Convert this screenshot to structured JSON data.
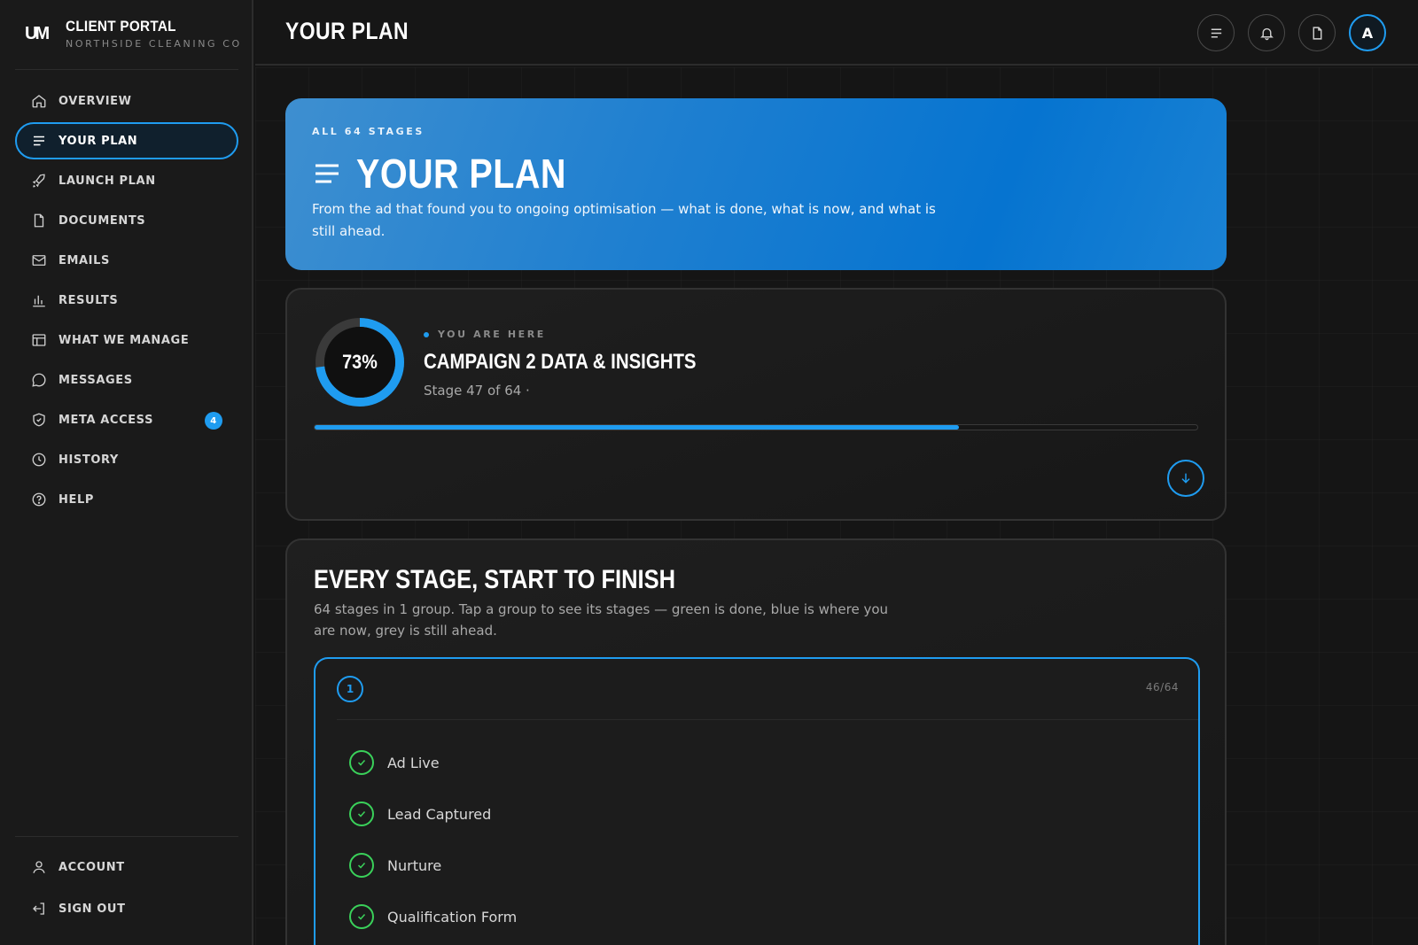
{
  "brand": {
    "logo": "UM",
    "title": "CLIENT PORTAL",
    "subtitle": "NORTHSIDE CLEANING CO"
  },
  "sidebar": {
    "items": [
      {
        "label": "OVERVIEW",
        "icon": "home-icon"
      },
      {
        "label": "YOUR PLAN",
        "icon": "list-icon",
        "active": true
      },
      {
        "label": "LAUNCH PLAN",
        "icon": "rocket-icon"
      },
      {
        "label": "DOCUMENTS",
        "icon": "document-icon"
      },
      {
        "label": "EMAILS",
        "icon": "mail-icon"
      },
      {
        "label": "RESULTS",
        "icon": "bar-chart-icon"
      },
      {
        "label": "WHAT WE MANAGE",
        "icon": "layout-icon"
      },
      {
        "label": "MESSAGES",
        "icon": "chat-icon"
      },
      {
        "label": "META ACCESS",
        "icon": "shield-icon",
        "badge": "4"
      },
      {
        "label": "HISTORY",
        "icon": "clock-icon"
      },
      {
        "label": "HELP",
        "icon": "help-icon"
      }
    ],
    "bottom": [
      {
        "label": "ACCOUNT",
        "icon": "user-icon"
      },
      {
        "label": "SIGN OUT",
        "icon": "sign-out-icon"
      }
    ]
  },
  "topbar": {
    "title": "YOUR PLAN",
    "avatar": "A"
  },
  "hero": {
    "eyebrow": "ALL 64 STAGES",
    "title": "YOUR PLAN",
    "description": "From the ad that found you to ongoing optimisation — what is done, what is now, and what is still ahead."
  },
  "progress": {
    "percent_label": "73%",
    "percent": 73,
    "eyebrow": "YOU ARE HERE",
    "stage_name": "CAMPAIGN 2 DATA & INSIGHTS",
    "stage_sub": "Stage 47 of 64 ·"
  },
  "stages": {
    "title": "EVERY STAGE, START TO FINISH",
    "description": "64 stages in 1 group. Tap a group to see its stages — green is done, blue is where you are now, grey is still ahead.",
    "group": {
      "number": "1",
      "count": "46/64",
      "items": [
        "Ad Live",
        "Lead Captured",
        "Nurture",
        "Qualification Form"
      ]
    }
  },
  "colors": {
    "accent": "#1f9cf0",
    "done": "#3ad15a",
    "background": "#151515"
  }
}
